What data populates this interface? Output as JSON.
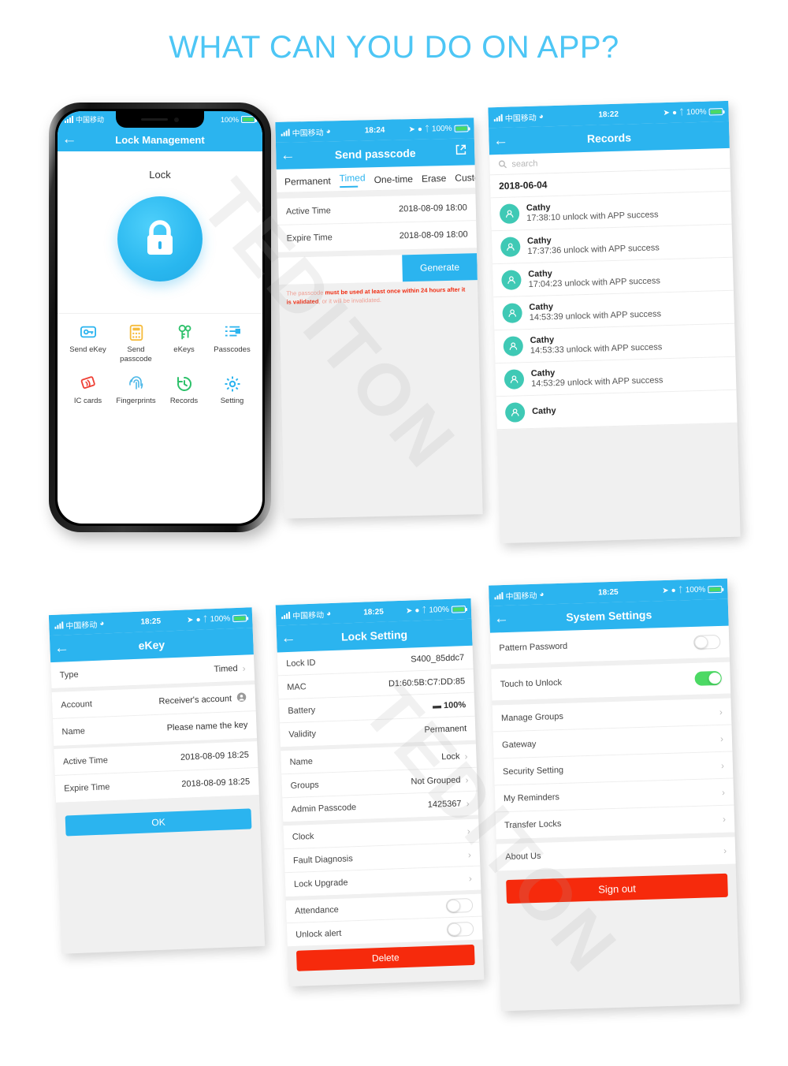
{
  "title": "WHAT CAN YOU DO ON APP?",
  "watermark": "TEDITON",
  "colors": {
    "brand_blue": "#2bb4ef",
    "title_blue": "#4dc6f5",
    "danger_red": "#f62a0c",
    "toggle_green": "#4cd964",
    "battery_green": "#23c24a",
    "avatar_teal": "#3fc9b5"
  },
  "status_bar": {
    "carrier": "中国移动",
    "wifi": "wifi-icon",
    "battery_pct": "100%"
  },
  "screen_lock_management": {
    "status_time": "",
    "nav_title": "Lock Management",
    "back": "back-arrow",
    "lock_label": "Lock",
    "lock_icon": "padlock-icon",
    "actions": [
      {
        "label": "Send eKey",
        "icon": "send-ekey-icon",
        "color": "#2bb4ef"
      },
      {
        "label": "Send passcode",
        "icon": "send-passcode-icon",
        "color": "#f6bc3d"
      },
      {
        "label": "eKeys",
        "icon": "ekeys-icon",
        "color": "#2ec16b"
      },
      {
        "label": "Passcodes",
        "icon": "passcodes-icon",
        "color": "#2bb4ef"
      },
      {
        "label": "IC cards",
        "icon": "ic-cards-icon",
        "color": "#ef4136"
      },
      {
        "label": "Fingerprints",
        "icon": "fingerprint-icon",
        "color": "#4db8e8"
      },
      {
        "label": "Records",
        "icon": "records-clock-icon",
        "color": "#2ec16b"
      },
      {
        "label": "Setting",
        "icon": "gear-icon",
        "color": "#2bb4ef"
      }
    ]
  },
  "screen_send_passcode": {
    "status_time": "18:24",
    "nav_title": "Send passcode",
    "share_icon": "share-export-icon",
    "tabs": [
      {
        "label": "Permanent",
        "active": false
      },
      {
        "label": "Timed",
        "active": true
      },
      {
        "label": "One-time",
        "active": false
      },
      {
        "label": "Erase",
        "active": false
      },
      {
        "label": "Custom",
        "active": false
      }
    ],
    "rows": [
      {
        "label": "Active Time",
        "value": "2018-08-09 18:00"
      },
      {
        "label": "Expire Time",
        "value": "2018-08-09 18:00"
      }
    ],
    "input_value": "",
    "generate_label": "Generate",
    "warning_prefix": "The passcode ",
    "warning_strong1": "must be used at least once within 24 hours after it is validated",
    "warning_suffix": ", or it will be invalidated."
  },
  "screen_records": {
    "status_time": "18:22",
    "nav_title": "Records",
    "search_placeholder": "search",
    "search_icon": "magnifier-icon",
    "date_header": "2018-06-04",
    "entries": [
      {
        "name": "Cathy",
        "detail": "17:38:10 unlock with APP success"
      },
      {
        "name": "Cathy",
        "detail": "17:37:36 unlock with APP success"
      },
      {
        "name": "Cathy",
        "detail": "17:04:23 unlock with APP success"
      },
      {
        "name": "Cathy",
        "detail": "14:53:39 unlock with APP success"
      },
      {
        "name": "Cathy",
        "detail": "14:53:33 unlock with APP success"
      },
      {
        "name": "Cathy",
        "detail": "14:53:29 unlock with APP success"
      },
      {
        "name": "Cathy",
        "detail": ""
      }
    ]
  },
  "screen_ekey": {
    "status_time": "18:25",
    "nav_title": "eKey",
    "rows": [
      {
        "label": "Type",
        "value": "Timed",
        "chevron": true
      },
      {
        "label": "Account",
        "value": "Receiver's account",
        "placeholder": true,
        "icon": "contact-icon"
      },
      {
        "label": "Name",
        "value": "Please name the key",
        "placeholder": true
      },
      {
        "label": "Active Time",
        "value": "2018-08-09 18:25"
      },
      {
        "label": "Expire Time",
        "value": "2018-08-09 18:25"
      }
    ],
    "ok_label": "OK"
  },
  "screen_lock_setting": {
    "status_time": "18:25",
    "nav_title": "Lock Setting",
    "rows": [
      {
        "label": "Lock ID",
        "value": "S400_85ddc7"
      },
      {
        "label": "MAC",
        "value": "D1:60:5B:C7:DD:85"
      },
      {
        "label": "Battery",
        "value": "100%",
        "battery": true
      },
      {
        "label": "Validity",
        "value": "Permanent"
      },
      {
        "label": "Name",
        "value": "Lock",
        "chevron": true
      },
      {
        "label": "Groups",
        "value": "Not Grouped",
        "chevron": true
      },
      {
        "label": "Admin Passcode",
        "value": "1425367",
        "chevron": true
      },
      {
        "label": "Clock",
        "value": "",
        "chevron": true
      },
      {
        "label": "Fault Diagnosis",
        "value": "",
        "chevron": true
      },
      {
        "label": "Lock Upgrade",
        "value": "",
        "chevron": true
      },
      {
        "label": "Attendance",
        "value": "",
        "toggle": "off"
      },
      {
        "label": "Unlock alert",
        "value": "",
        "toggle": "off"
      }
    ],
    "delete_label": "Delete"
  },
  "screen_system_settings": {
    "status_time": "18:25",
    "nav_title": "System Settings",
    "rows": [
      {
        "label": "Pattern Password",
        "toggle": "off"
      },
      {
        "label": "Touch to Unlock",
        "toggle": "on"
      },
      {
        "label": "Manage Groups",
        "chevron": true
      },
      {
        "label": "Gateway",
        "chevron": true
      },
      {
        "label": "Security Setting",
        "chevron": true
      },
      {
        "label": "My Reminders",
        "chevron": true
      },
      {
        "label": "Transfer Locks",
        "chevron": true
      },
      {
        "label": "About Us",
        "chevron": true
      }
    ],
    "signout_label": "Sign out"
  }
}
